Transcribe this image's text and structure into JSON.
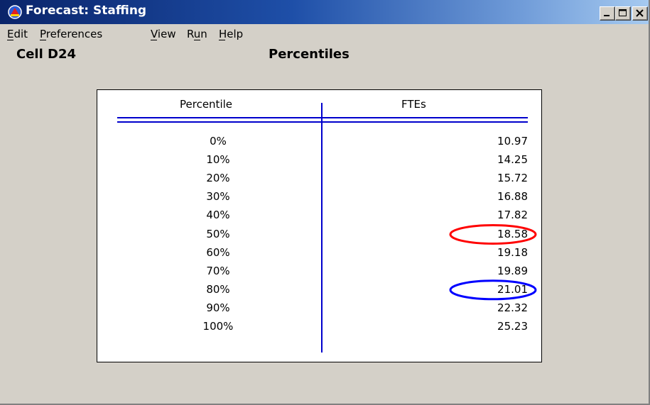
{
  "window": {
    "title": "Forecast: Staffing",
    "icon": "crystal-ball-app-icon"
  },
  "window_controls": {
    "minimize": "minimize-icon",
    "maximize": "maximize-icon",
    "close": "close-icon"
  },
  "menu": {
    "items": [
      "Edit",
      "Preferences",
      "View",
      "Run",
      "Help"
    ]
  },
  "header": {
    "cell": "Cell D24",
    "view": "Percentiles"
  },
  "table": {
    "columns": [
      "Percentile",
      "FTEs"
    ],
    "rows": [
      {
        "percentile": "0%",
        "value": "10.97"
      },
      {
        "percentile": "10%",
        "value": "14.25"
      },
      {
        "percentile": "20%",
        "value": "15.72"
      },
      {
        "percentile": "30%",
        "value": "16.88"
      },
      {
        "percentile": "40%",
        "value": "17.82"
      },
      {
        "percentile": "50%",
        "value": "18.58"
      },
      {
        "percentile": "60%",
        "value": "19.18"
      },
      {
        "percentile": "70%",
        "value": "19.89"
      },
      {
        "percentile": "80%",
        "value": "21.01"
      },
      {
        "percentile": "90%",
        "value": "22.32"
      },
      {
        "percentile": "100%",
        "value": "25.23"
      }
    ]
  },
  "highlights": [
    {
      "row_value": "18.58",
      "color": "#ff0000"
    },
    {
      "row_value": "21.01",
      "color": "#0000ff"
    }
  ],
  "colors": {
    "rule": "#0000cc",
    "title_start": "#0a246a",
    "title_end": "#a6caf0"
  }
}
